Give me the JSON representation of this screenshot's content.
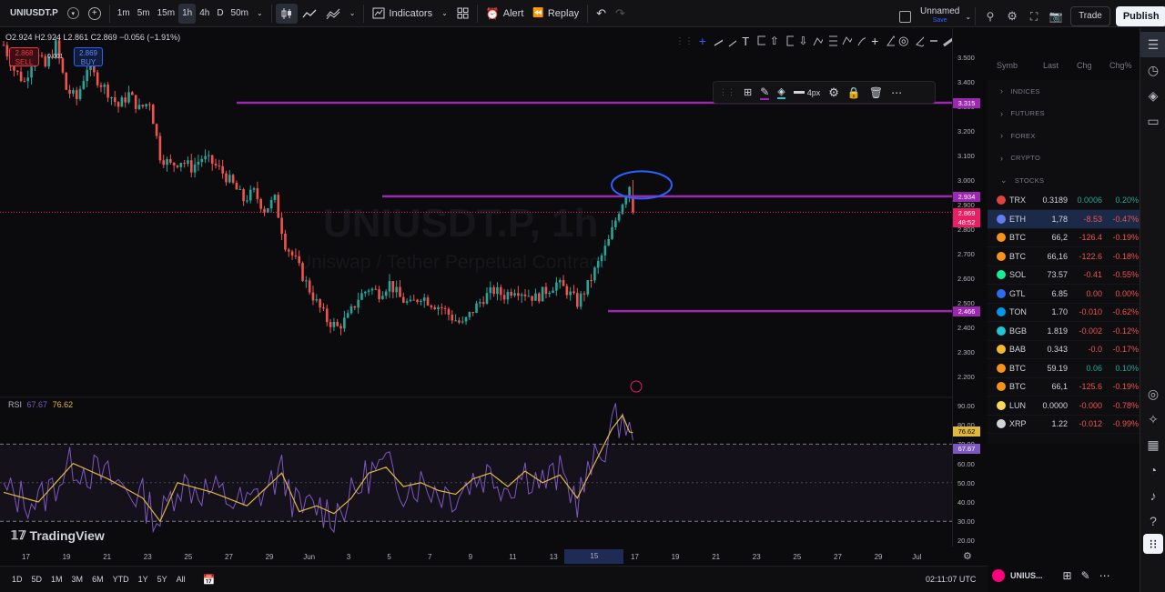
{
  "toolbar": {
    "symbol": "UNIUSDT.P",
    "timeframes": [
      "1m",
      "5m",
      "15m",
      "1h",
      "4h",
      "D",
      "50m"
    ],
    "active_timeframe": "1h",
    "indicators_label": "Indicators",
    "alert_label": "Alert",
    "replay_label": "Replay",
    "layout_name": "Unnamed",
    "layout_status": "Save",
    "trade_label": "Trade",
    "publish_label": "Publish"
  },
  "legend": {
    "ohlc": "O2.924 H2.924 L2.861 C2.869 −0.056 (−1.91%)",
    "sell_price": "2.868",
    "sell_label": "SELL",
    "spread": "0.001",
    "buy_price": "2.869",
    "buy_label": "BUY"
  },
  "watermark": {
    "line1": "UNIUSDT.P, 1h",
    "line2": "Uniswap / Tether Perpetual Contract"
  },
  "float_toolbar": {
    "width_label": "4px"
  },
  "price_axis": {
    "ticks": [
      "3.500",
      "3.400",
      "3.300",
      "3.200",
      "3.100",
      "3.000",
      "2.900",
      "2.800",
      "2.700",
      "2.600",
      "2.500",
      "2.400",
      "2.300",
      "2.200"
    ],
    "label_resistance": "3.315",
    "label_level": "2.934",
    "label_current": "2.869",
    "label_countdown": "48:52",
    "label_support": "2.466"
  },
  "rsi": {
    "name": "RSI",
    "value1": "67.67",
    "value2": "76.62",
    "ticks": [
      "90.00",
      "80.00",
      "70.00",
      "60.00",
      "50.00",
      "40.00",
      "30.00",
      "20.00"
    ]
  },
  "time_axis": [
    "17",
    "19",
    "21",
    "23",
    "25",
    "27",
    "29",
    "Jun",
    "3",
    "5",
    "7",
    "9",
    "11",
    "13",
    "15",
    "17",
    "19",
    "21",
    "23",
    "25",
    "27",
    "29",
    "Jul"
  ],
  "highlight_time": "15",
  "branding": "TradingView",
  "bottombar": {
    "ranges": [
      "1D",
      "5D",
      "1M",
      "3M",
      "6M",
      "YTD",
      "1Y",
      "5Y",
      "All"
    ],
    "clock": "02:11:07 UTC",
    "symbol_short": "UNIUS..."
  },
  "watchlist": {
    "headers": [
      "Symb",
      "Last",
      "Chg",
      "Chg%"
    ],
    "sections": [
      "INDICES",
      "FUTURES",
      "FOREX",
      "CRYPTO",
      "STOCKS"
    ],
    "rows": [
      {
        "sym": "TRX",
        "last": "0.3189",
        "chg": "0.0006",
        "pct": "0.20%",
        "dir": "up",
        "color": "#e0423d"
      },
      {
        "sym": "ETH",
        "last": "1,78",
        "chg": "-8.53",
        "pct": "-0.47%",
        "dir": "down",
        "color": "#627eea"
      },
      {
        "sym": "BTC",
        "last": "66,2",
        "chg": "-126.4",
        "pct": "-0.19%",
        "dir": "down",
        "color": "#f7931a"
      },
      {
        "sym": "BTC",
        "last": "66,16",
        "chg": "-122.6",
        "pct": "-0.18%",
        "dir": "down",
        "color": "#f7931a"
      },
      {
        "sym": "SOL",
        "last": "73.57",
        "chg": "-0.41",
        "pct": "-0.55%",
        "dir": "down",
        "color": "#14f195"
      },
      {
        "sym": "GTL",
        "last": "6.85",
        "chg": "0.00",
        "pct": "0.00%",
        "dir": "down",
        "color": "#2b6def"
      },
      {
        "sym": "TON",
        "last": "1.70",
        "chg": "-0.010",
        "pct": "-0.62%",
        "dir": "down",
        "color": "#0098ea"
      },
      {
        "sym": "BGB",
        "last": "1.819",
        "chg": "-0.002",
        "pct": "-0.12%",
        "dir": "down",
        "color": "#1fc7d4"
      },
      {
        "sym": "BAB",
        "last": "0.343",
        "chg": "-0.0",
        "pct": "-0.17%",
        "dir": "down",
        "color": "#f3ba2f"
      },
      {
        "sym": "BTC",
        "last": "59.19",
        "chg": "0.06",
        "pct": "0.10%",
        "dir": "up",
        "color": "#f7931a"
      },
      {
        "sym": "BTC",
        "last": "66,1",
        "chg": "-125.6",
        "pct": "-0.19%",
        "dir": "down",
        "color": "#f7931a"
      },
      {
        "sym": "LUN",
        "last": "0.0000",
        "chg": "-0.000",
        "pct": "-0.78%",
        "dir": "down",
        "color": "#f9d85e"
      },
      {
        "sym": "XRP",
        "last": "1.22",
        "chg": "-0.012",
        "pct": "-0.99%",
        "dir": "down",
        "color": "#d1d4dc"
      }
    ]
  },
  "colors": {
    "up": "#26a69a",
    "down": "#ef5350",
    "level_line": "#9c27b0",
    "rsi_line": "#7e57c2",
    "rsi_ma": "#e0b83a",
    "current_price": "#e91e63"
  },
  "chart_data": {
    "type": "candlestick",
    "horizontal_levels": [
      3.315,
      2.934,
      2.466
    ],
    "current_price": 2.869,
    "price_range": [
      2.2,
      3.5
    ],
    "path_points": [
      [
        0,
        3.55
      ],
      [
        3,
        3.45
      ],
      [
        6,
        3.4
      ],
      [
        9,
        3.52
      ],
      [
        12,
        3.46
      ],
      [
        15,
        3.55
      ],
      [
        18,
        3.37
      ],
      [
        21,
        3.33
      ],
      [
        24,
        3.46
      ],
      [
        27,
        3.41
      ],
      [
        30,
        3.36
      ],
      [
        33,
        3.3
      ],
      [
        36,
        3.35
      ],
      [
        39,
        3.29
      ],
      [
        42,
        3.32
      ],
      [
        45,
        3.1
      ],
      [
        48,
        3.06
      ],
      [
        51,
        3.08
      ],
      [
        54,
        3.05
      ],
      [
        57,
        3.09
      ],
      [
        60,
        3.07
      ],
      [
        63,
        3.03
      ],
      [
        66,
        2.98
      ],
      [
        69,
        2.92
      ],
      [
        72,
        2.95
      ],
      [
        75,
        2.88
      ],
      [
        78,
        2.92
      ],
      [
        81,
        2.74
      ],
      [
        84,
        2.67
      ],
      [
        87,
        2.58
      ],
      [
        90,
        2.5
      ],
      [
        93,
        2.43
      ],
      [
        96,
        2.4
      ],
      [
        99,
        2.44
      ],
      [
        102,
        2.52
      ],
      [
        105,
        2.56
      ],
      [
        108,
        2.54
      ],
      [
        111,
        2.58
      ],
      [
        114,
        2.52
      ],
      [
        117,
        2.49
      ],
      [
        120,
        2.53
      ],
      [
        123,
        2.5
      ],
      [
        126,
        2.48
      ],
      [
        129,
        2.44
      ],
      [
        132,
        2.41
      ],
      [
        135,
        2.47
      ],
      [
        138,
        2.52
      ],
      [
        141,
        2.55
      ],
      [
        144,
        2.53
      ],
      [
        147,
        2.56
      ],
      [
        150,
        2.54
      ],
      [
        153,
        2.52
      ],
      [
        156,
        2.55
      ],
      [
        159,
        2.58
      ],
      [
        162,
        2.55
      ],
      [
        165,
        2.5
      ],
      [
        168,
        2.57
      ],
      [
        171,
        2.66
      ],
      [
        174,
        2.75
      ],
      [
        177,
        2.88
      ],
      [
        180,
        2.98
      ],
      [
        181,
        2.869
      ]
    ],
    "rsi_points": [
      [
        0,
        45
      ],
      [
        10,
        40
      ],
      [
        20,
        60
      ],
      [
        30,
        52
      ],
      [
        40,
        42
      ],
      [
        45,
        30
      ],
      [
        50,
        50
      ],
      [
        60,
        45
      ],
      [
        70,
        38
      ],
      [
        80,
        55
      ],
      [
        85,
        35
      ],
      [
        90,
        38
      ],
      [
        95,
        34
      ],
      [
        100,
        42
      ],
      [
        105,
        55
      ],
      [
        110,
        58
      ],
      [
        115,
        48
      ],
      [
        120,
        50
      ],
      [
        125,
        46
      ],
      [
        130,
        44
      ],
      [
        135,
        52
      ],
      [
        140,
        55
      ],
      [
        145,
        48
      ],
      [
        150,
        56
      ],
      [
        155,
        50
      ],
      [
        160,
        54
      ],
      [
        165,
        42
      ],
      [
        170,
        60
      ],
      [
        175,
        78
      ],
      [
        178,
        85
      ],
      [
        181,
        72
      ]
    ]
  }
}
